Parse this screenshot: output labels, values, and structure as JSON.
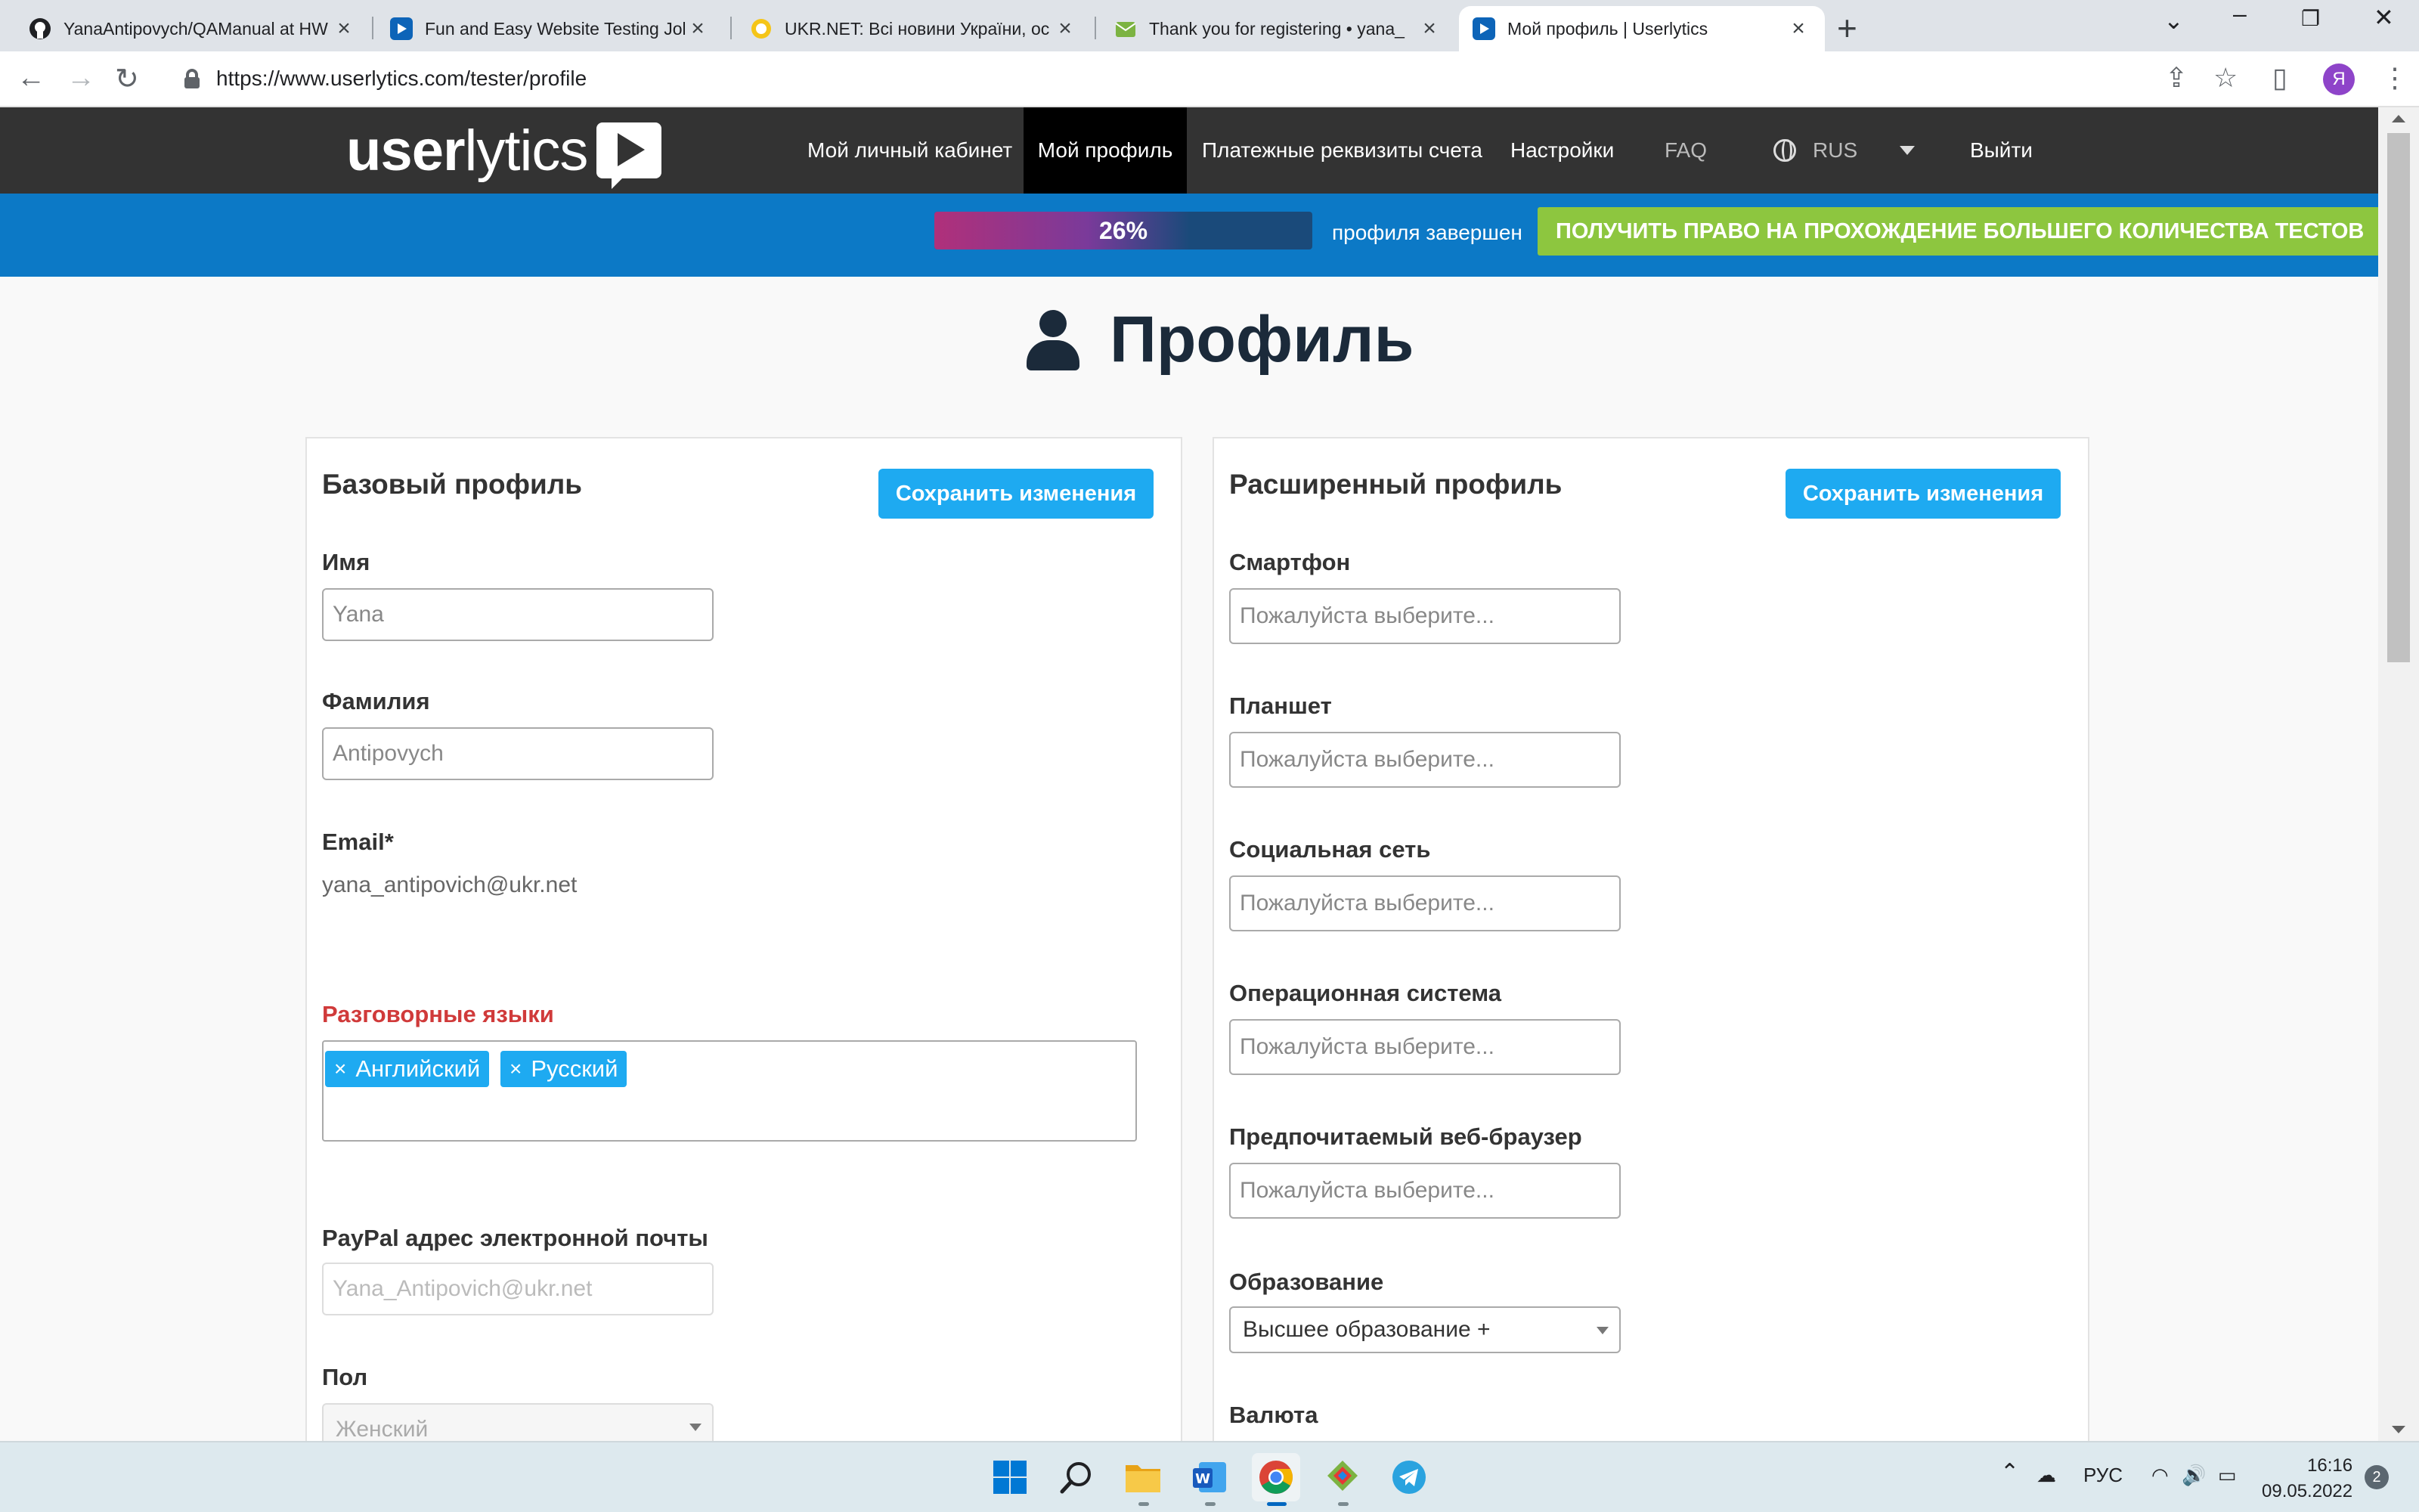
{
  "browser": {
    "tabs": [
      {
        "title": "YanaAntipovych/QAManual at HW",
        "icon": "github-icon"
      },
      {
        "title": "Fun and Easy Website Testing Job",
        "icon": "userlytics-icon"
      },
      {
        "title": "UKR.NET: Всі новини України, ос",
        "icon": "ukrnet-icon"
      },
      {
        "title": "Thank you for registering • yana_",
        "icon": "mail-icon"
      },
      {
        "title": "Мой профиль | Userlytics",
        "icon": "userlytics-icon"
      }
    ],
    "url": "https://www.userlytics.com/tester/profile",
    "profile_initial": "Я"
  },
  "site": {
    "logo_bold": "user",
    "logo_light": "lytics",
    "nav": {
      "dashboard": "Мой личный кабинет",
      "profile": "Мой профиль",
      "payment": "Платежные реквизиты счета",
      "settings": "Настройки",
      "faq": "FAQ",
      "language": "RUS",
      "logout": "Выйти"
    },
    "progress": {
      "value": 0.26,
      "label": "26%",
      "text": "профиля завершен"
    },
    "cta": "ПОЛУЧИТЬ ПРАВО НА ПРОХОЖДЕНИЕ БОЛЬШЕГО КОЛИЧЕСТВА ТЕСТОВ",
    "colors": {
      "nav_bg": "#333333",
      "band_bg": "#0c79c6",
      "accent": "#1eaaf1",
      "cta": "#8dc63f"
    }
  },
  "page": {
    "title": "Профиль",
    "basic": {
      "title": "Базовый профиль",
      "save": "Сохранить изменения",
      "first_name_label": "Имя",
      "first_name_value": "Yana",
      "last_name_label": "Фамилия",
      "last_name_value": "Antipovych",
      "email_label": "Email*",
      "email_value": "yana_antipovich@ukr.net",
      "languages_label": "Разговорные языки",
      "languages": [
        "Английский",
        "Русский"
      ],
      "paypal_label": "PayPal адрес электронной почты",
      "paypal_value": "Yana_Antipovich@ukr.net",
      "gender_label": "Пол",
      "gender_value": "Женский"
    },
    "extended": {
      "title": "Расширенный профиль",
      "save": "Сохранить изменения",
      "placeholder": "Пожалуйста выберите...",
      "smartphone_label": "Смартфон",
      "tablet_label": "Планшет",
      "social_label": "Социальная сеть",
      "os_label": "Операционная система",
      "browser_label": "Предпочитаемый веб-браузер",
      "education_label": "Образование",
      "education_value": "Высшее образование +",
      "currency_label": "Валюта"
    }
  },
  "taskbar": {
    "apps": [
      "windows-start",
      "search",
      "file-explorer",
      "word",
      "chrome",
      "app",
      "telegram"
    ],
    "lang": "РУС",
    "time": "16:16",
    "date": "09.05.2022",
    "notifications": "2"
  }
}
